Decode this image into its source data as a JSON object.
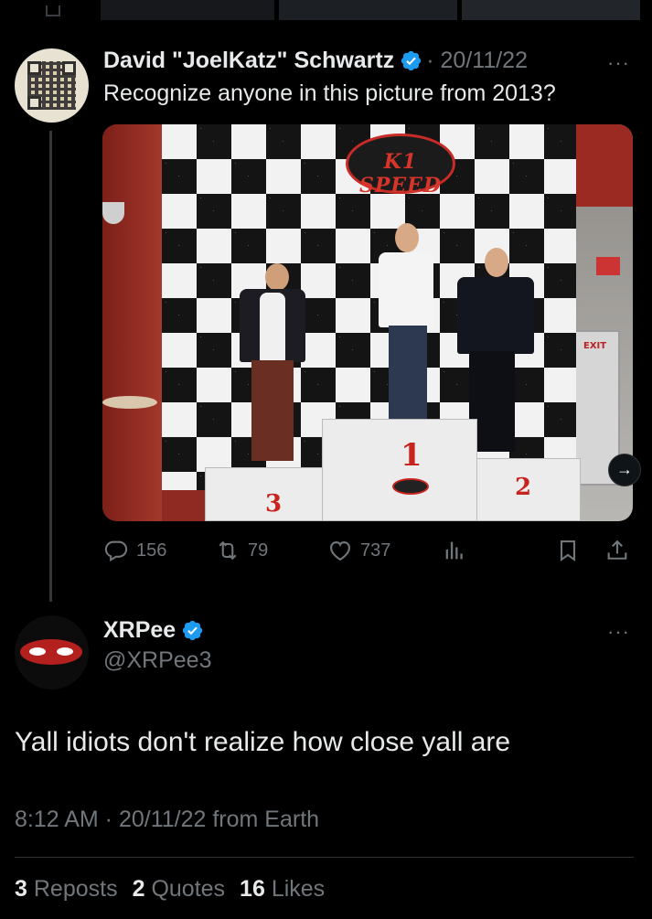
{
  "tweet1": {
    "author_name": "David \"JoelKatz\" Schwartz",
    "date": "· 20/11/22",
    "text": "Recognize anyone in this picture from 2013?",
    "more_label": "···",
    "photo": {
      "logo_text": "K1 SPEED",
      "exit_text": "EXIT",
      "podium_labels": [
        "1",
        "2",
        "3"
      ]
    },
    "actions": {
      "replies": "156",
      "reposts": "79",
      "likes": "737"
    }
  },
  "tweet2": {
    "author_name": "XRPee",
    "handle": "@XRPee3",
    "more_label": "···",
    "text": "Yall idiots don't realize how close yall are",
    "meta": "8:12 AM · 20/11/22 from Earth",
    "stats": [
      {
        "count": "3",
        "label": "Reposts"
      },
      {
        "count": "2",
        "label": "Quotes"
      },
      {
        "count": "16",
        "label": "Likes"
      }
    ]
  },
  "colors": {
    "background": "#000000",
    "primary_text": "#e7e9ea",
    "secondary_text": "#71767b",
    "verified_blue": "#1d9bf0",
    "divider": "#2f3336"
  },
  "icons": [
    "reply-icon",
    "retweet-icon",
    "like-icon",
    "views-icon",
    "bookmark-icon",
    "share-icon",
    "verified-badge-icon",
    "more-icon",
    "next-arrow-icon"
  ]
}
